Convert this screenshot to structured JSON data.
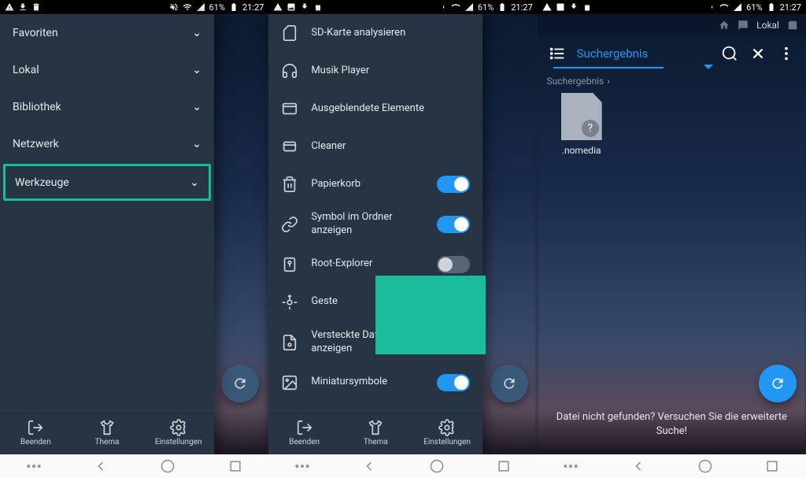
{
  "status": {
    "battery": "61%",
    "time": "21:27"
  },
  "screen1": {
    "drawer_items": [
      {
        "label": "Favoriten",
        "highlight": false
      },
      {
        "label": "Lokal",
        "highlight": false
      },
      {
        "label": "Bibliothek",
        "highlight": false
      },
      {
        "label": "Netzwerk",
        "highlight": false
      },
      {
        "label": "Werkzeuge",
        "highlight": true
      }
    ],
    "bottombar": {
      "beenden": "Beenden",
      "thema": "Thema",
      "einstellungen": "Einstellungen"
    }
  },
  "screen2": {
    "settings": [
      {
        "icon": "sdcard-icon",
        "label": "SD-Karte analysieren",
        "toggle": null
      },
      {
        "icon": "headphones-icon",
        "label": "Musik Player",
        "toggle": null
      },
      {
        "icon": "hidden-icon",
        "label": "Ausgeblendete Elemente",
        "toggle": null
      },
      {
        "icon": "cleaner-icon",
        "label": "Cleaner",
        "toggle": null
      },
      {
        "icon": "trash-icon",
        "label": "Papierkorb",
        "toggle": true
      },
      {
        "icon": "link-icon",
        "label": "Symbol im Ordner anzeigen",
        "toggle": true
      },
      {
        "icon": "root-icon",
        "label": "Root-Explorer",
        "toggle": false
      },
      {
        "icon": "gesture-icon",
        "label": "Geste",
        "toggle": false
      },
      {
        "icon": "hiddenfile-icon",
        "label": "Versteckte Dateien anzeigen",
        "toggle": true
      },
      {
        "icon": "thumbnail-icon",
        "label": "Miniatursymbole",
        "toggle": true
      }
    ],
    "bottombar": {
      "beenden": "Beenden",
      "thema": "Thema",
      "einstellungen": "Einstellungen"
    }
  },
  "screen3": {
    "topbar_label": "Lokal",
    "title": "Suchergebnis",
    "breadcrumb": "Suchergebnis",
    "file_name": ".nomedia",
    "tip": "Datei nicht gefunden? Versuchen Sie die erweiterte Suche!"
  }
}
